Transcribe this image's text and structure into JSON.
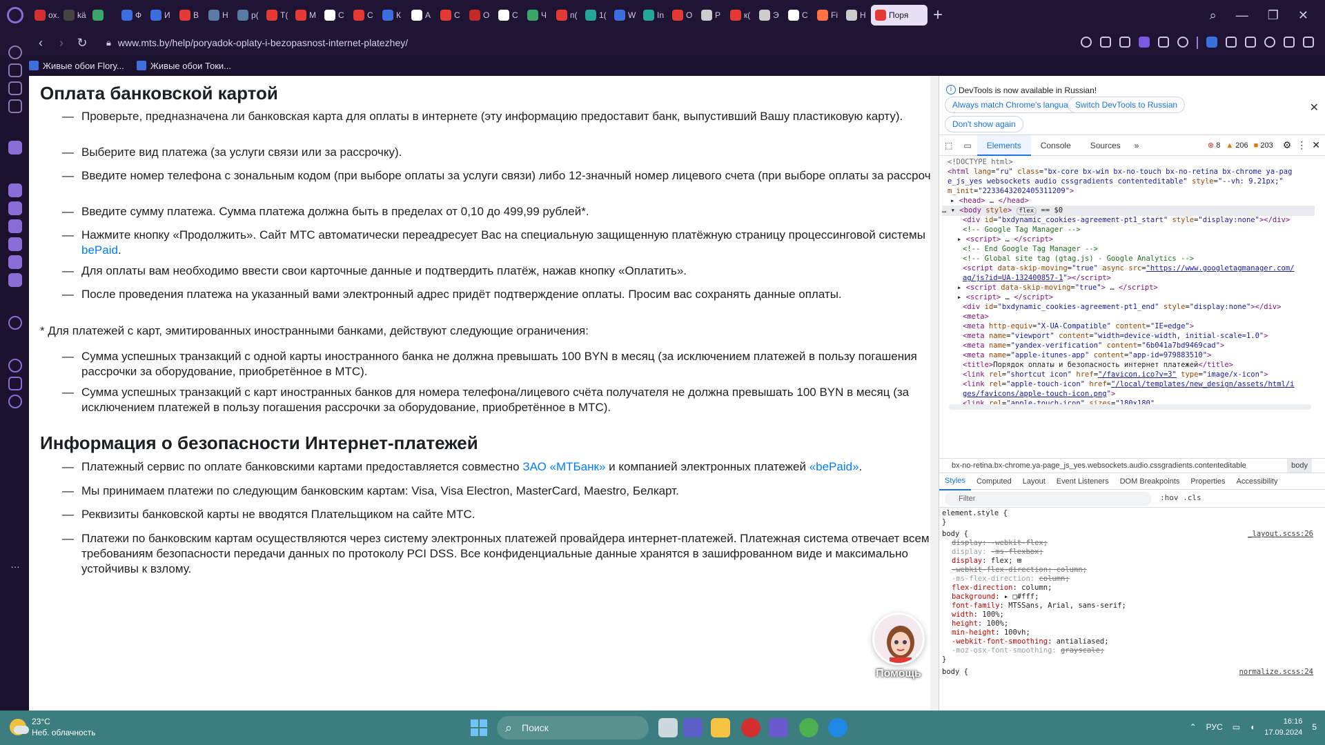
{
  "browser": {
    "tabs": [
      {
        "label": "ox. Di",
        "color": "#d32f2f"
      },
      {
        "label": "kä",
        "color": "#444"
      },
      {
        "label": "",
        "color": "#3aa66a"
      },
      {
        "label": "Ф",
        "color": "#3b6fe0"
      },
      {
        "label": "И",
        "color": "#3b6fe0"
      },
      {
        "label": "В",
        "color": "#e53935"
      },
      {
        "label": "Н",
        "color": "#5a7ba8"
      },
      {
        "label": "р(",
        "color": "#5a7ba8"
      },
      {
        "label": "Т(",
        "color": "#e53935"
      },
      {
        "label": "М",
        "color": "#e53935"
      },
      {
        "label": "С",
        "color": "#ffffff"
      },
      {
        "label": "С",
        "color": "#e53935"
      },
      {
        "label": "К",
        "color": "#3b6fe0"
      },
      {
        "label": "А",
        "color": "#ffffff"
      },
      {
        "label": "С",
        "color": "#e53935"
      },
      {
        "label": "О",
        "color": "#c62828"
      },
      {
        "label": "С",
        "color": "#ffffff"
      },
      {
        "label": "Ч",
        "color": "#3aa66a"
      },
      {
        "label": "п(",
        "color": "#e53935"
      },
      {
        "label": "1(",
        "color": "#26a69a"
      },
      {
        "label": "W",
        "color": "#3b6fe0"
      },
      {
        "label": "In",
        "color": "#26a69a"
      },
      {
        "label": "О",
        "color": "#e53935"
      },
      {
        "label": "Р",
        "color": "#cccccc"
      },
      {
        "label": "к(",
        "color": "#e53935"
      },
      {
        "label": "Э",
        "color": "#cccccc"
      },
      {
        "label": "С",
        "color": "#ffffff"
      },
      {
        "label": "Fi",
        "color": "#ff7043"
      },
      {
        "label": "Н",
        "color": "#cccccc"
      }
    ],
    "active_tab": {
      "label": "Поря",
      "color": "#e53935"
    },
    "new_tab": "+",
    "url": "www.mts.by/help/poryadok-oplaty-i-bezopasnost-internet-platezhey/",
    "bookmarks": [
      "Живые обои Flory...",
      "Живые обои Токи..."
    ]
  },
  "page": {
    "section1_title": "Оплата банковской картой",
    "steps": [
      {
        "text": "Проверьте, предназначена ли банковская карта для оплаты в интернете (эту информацию предоставит банк, выпустивший Вашу пластиковую карту)."
      },
      {
        "text": "Выберите вид платежа (за услуги связи или за рассрочку)."
      },
      {
        "text": "Введите номер телефона с зональным кодом (при выборе оплаты за услуги связи) либо 12-значный номер лицевого счета (при выборе оплаты за рассрочку)."
      },
      {
        "text": "Введите сумму платежа. Сумма платежа должна быть в пределах от 0,10 до 499,99 рублей*."
      },
      {
        "text": "Нажмите кнопку «Продолжить». Сайт МТС автоматически переадресует Вас на специальную защищенную платёжную страницу процессинговой системы ",
        "link": "bePaid",
        "after": "."
      },
      {
        "text": "Для оплаты вам необходимо ввести свои карточные данные и подтвердить платёж, нажав кнопку «Оплатить»."
      },
      {
        "text": "После проведения платежа на указанный вами электронный адрес придёт подтверждение оплаты. Просим вас сохранять данные оплаты."
      }
    ],
    "foreign_note": "* Для платежей с карт, эмитированных иностранными банками, действуют следующие ограничения:",
    "limits": [
      {
        "text": "Сумма успешных транзакций с одной карты иностранного банка не должна превышать 100 BYN в месяц (за исключением платежей в пользу погашения рассрочки за оборудование, приобретённое в МТС)."
      },
      {
        "text": "Сумма успешных транзакций с карт иностранных банков для номера телефона/лицевого счёта получателя не должна превышать 100 BYN в месяц (за исключением платежей в пользу погашения рассрочки за оборудование, приобретённое в МТС)."
      }
    ],
    "section2_title": "Информация о безопасности Интернет-платежей",
    "security": [
      {
        "text": "Платежный сервис по оплате банковскими картами предоставляется совместно ",
        "link1": "ЗАО «МТБанк»",
        "mid": " и компанией электронных платежей ",
        "link2": "«bePaid»",
        "after": "."
      },
      {
        "text": "Мы принимаем платежи по следующим банковским картам: Visa, Visa Electron, MasterCard, Maestro, Белкарт."
      },
      {
        "text": "Реквизиты банковской карты не вводятся Плательщиком на сайте МТС."
      },
      {
        "text": "Платежи по банковским картам осуществляются через систему электронных платежей провайдера интернет-платежей. Платежная система отвечает всем требованиям безопасности передачи данных по протоколу PCI DSS. Все конфиденциальные данные хранятся в зашифрованном виде и максимально устойчивы к взлому."
      }
    ],
    "dash": "—",
    "help_label": "Помощь"
  },
  "devtools": {
    "info_text": "DevTools is now available in Russian!",
    "btn_match": "Always match Chrome's language",
    "btn_switch": "Switch DevTools to Russian",
    "btn_dont": "Don't show again",
    "tabs": [
      "Elements",
      "Console",
      "Sources"
    ],
    "errors": "8",
    "warnings": "206",
    "issues": "203",
    "breadcrumb": "bx-no-retina.bx-chrome.ya-page_js_yes.websockets.audio.cssgradients.contenteditable",
    "breadcrumb_active": "body",
    "subtabs": [
      "Styles",
      "Computed",
      "Layout",
      "Event Listeners",
      "DOM Breakpoints",
      "Properties",
      "Accessibility"
    ],
    "filter_placeholder": "Filter",
    "filter_right": ":hov .cls",
    "layout_src": "_layout.scss:26",
    "normalize_src": "normalize.scss:24"
  },
  "taskbar": {
    "temp": "23°C",
    "weather": "Неб. облачность",
    "search": "Поиск",
    "lang": "РУС",
    "time": "16:16",
    "date": "17.09.2024",
    "notif": "5"
  }
}
